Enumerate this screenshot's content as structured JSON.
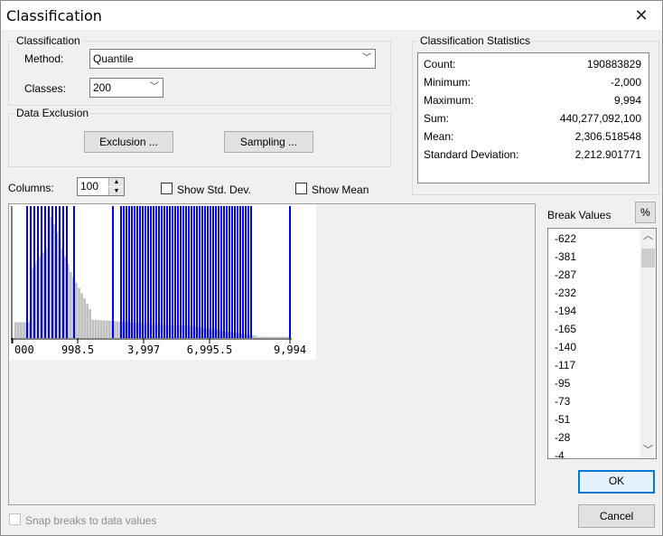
{
  "window": {
    "title": "Classification"
  },
  "classification": {
    "group_title": "Classification",
    "method_label": "Method:",
    "method_value": "Quantile",
    "classes_label": "Classes:",
    "classes_value": "200"
  },
  "exclusion": {
    "group_title": "Data Exclusion",
    "exclusion_button": "Exclusion ...",
    "sampling_button": "Sampling ..."
  },
  "stats": {
    "group_title": "Classification Statistics",
    "rows": [
      {
        "label": "Count:",
        "value": "190883829"
      },
      {
        "label": "Minimum:",
        "value": "-2,000"
      },
      {
        "label": "Maximum:",
        "value": "9,994"
      },
      {
        "label": "Sum:",
        "value": "440,277,092,100"
      },
      {
        "label": "Mean:",
        "value": "2,306.518548"
      },
      {
        "label": "Standard Deviation:",
        "value": "2,212.901771"
      }
    ]
  },
  "histogram_controls": {
    "columns_label": "Columns:",
    "columns_value": "100",
    "show_std_dev_label": "Show Std. Dev.",
    "show_std_dev_checked": false,
    "show_mean_label": "Show Mean",
    "show_mean_checked": false
  },
  "chart_data": {
    "type": "bar",
    "tick_labels": [
      "000",
      "998.5",
      "3,997",
      "6,995.5",
      "9,994"
    ],
    "histogram_color": "#c0c0c0",
    "break_line_color": "#0000ff"
  },
  "breaks": {
    "label": "Break Values",
    "percent_button": "%",
    "values": [
      "-622",
      "-381",
      "-287",
      "-232",
      "-194",
      "-165",
      "-140",
      "-117",
      "-95",
      "-73",
      "-51",
      "-28",
      "-4"
    ]
  },
  "buttons": {
    "ok": "OK",
    "cancel": "Cancel"
  },
  "snap": {
    "label": "Snap breaks to data values",
    "checked": false,
    "disabled": true
  }
}
